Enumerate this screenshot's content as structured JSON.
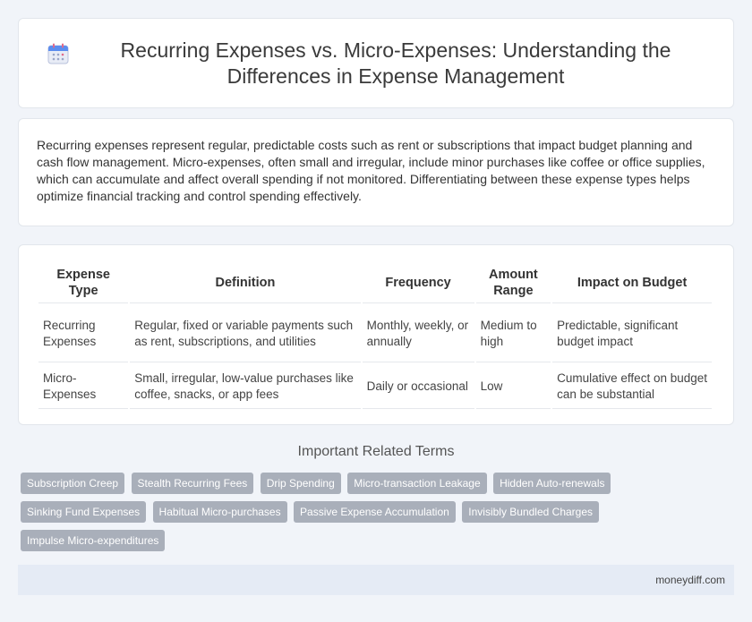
{
  "header": {
    "title": "Recurring Expenses vs. Micro-Expenses: Understanding the Differences in Expense Management",
    "icon": "calendar-icon"
  },
  "intro": {
    "text": "Recurring expenses represent regular, predictable costs such as rent or subscriptions that impact budget planning and cash flow management. Micro-expenses, often small and irregular, include minor purchases like coffee or office supplies, which can accumulate and affect overall spending if not monitored. Differentiating between these expense types helps optimize financial tracking and control spending effectively."
  },
  "table": {
    "headers": [
      "Expense Type",
      "Definition",
      "Frequency",
      "Amount Range",
      "Impact on Budget"
    ],
    "rows": [
      [
        "Recurring Expenses",
        "Regular, fixed or variable payments such as rent, subscriptions, and utilities",
        "Monthly, weekly, or annually",
        "Medium to high",
        "Predictable, significant budget impact"
      ],
      [
        "Micro-Expenses",
        "Small, irregular, low-value purchases like coffee, snacks, or app fees",
        "Daily or occasional",
        "Low",
        "Cumulative effect on budget can be substantial"
      ]
    ]
  },
  "related": {
    "title": "Important Related Terms",
    "tags": [
      "Subscription Creep",
      "Stealth Recurring Fees",
      "Drip Spending",
      "Micro-transaction Leakage",
      "Hidden Auto-renewals",
      "Sinking Fund Expenses",
      "Habitual Micro-purchases",
      "Passive Expense Accumulation",
      "Invisibly Bundled Charges",
      "Impulse Micro-expenditures"
    ]
  },
  "footer": {
    "site": "moneydiff.com"
  },
  "colors": {
    "tag_bg": "#a9afba",
    "page_bg": "#f1f4f9",
    "footer_bg": "#e5ebf5"
  }
}
